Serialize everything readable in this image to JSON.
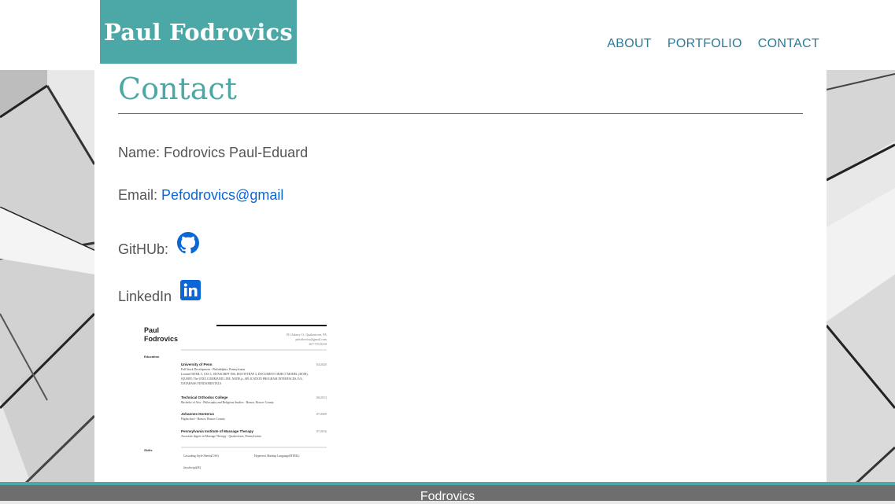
{
  "brand": {
    "name": "Paul Fodrovics"
  },
  "nav": [
    {
      "label": "ABOUT"
    },
    {
      "label": "PORTFOLIO"
    },
    {
      "label": "CONTACT"
    }
  ],
  "page": {
    "title": "Contact"
  },
  "contact": {
    "name_label": "Name:",
    "name_value": "Fodrovics Paul-Eduard",
    "email_label": "Email:",
    "email_value": "Pefodrovics@gmail",
    "github_label": "GitHUb:",
    "github_icon": "github-icon",
    "linkedin_label": "LinkedIn",
    "linkedin_icon": "linkedin-icon"
  },
  "resume": {
    "name_line1": "Paul",
    "name_line2": "Fodrovics",
    "address": "191 Asbury Ct, Quakertown, PA",
    "email": "pefodrovics@gmail.com",
    "phone": "267-733-8210",
    "education_label": "Education",
    "entries": [
      {
        "school": "University of Penn",
        "date": "04/2020",
        "sub": "Full Stack Development - Philadelphia, Pennsylvania",
        "desc1": "Learned HTML 5, CSS 3, JAVASCRIPT ES6, BOOTSTRAP 4, DOCUMENT OBJECT MODEL (DOM),",
        "desc2": "JQUERY, The UNIX COMMAND LINE, NODE.js, APLICATION PROGRAM INTERFACES, E/S,",
        "desc3": "DATABASE FUNDAMENTALS"
      },
      {
        "school": "Technical Orthodox College",
        "date": "06/2013",
        "sub": "Bachelor of Arts - Philosophy and Religious Studies - Brasov, Brasov County"
      },
      {
        "school": "Johannes Honterus",
        "date": "07/2009",
        "sub": "Highschool - Brasov, Brasov County"
      },
      {
        "school": "Pennsylvania Institute of Massage Therapy",
        "date": "07/2016",
        "sub": "Associate degree in Massage Therapy - Quakertown, Pennsylvania"
      }
    ],
    "skills_label": "Skills",
    "skills": [
      "Cascading Style Sheets(CSS)",
      "Hypertext Markup Language(HTML)",
      "JavaScript(JS)"
    ]
  },
  "footer": {
    "text": "Fodrovics"
  },
  "colors": {
    "accent": "#4ba8a6",
    "nav": "#2b7a99",
    "link": "#0b66d6",
    "footer": "#6e6e6e"
  }
}
